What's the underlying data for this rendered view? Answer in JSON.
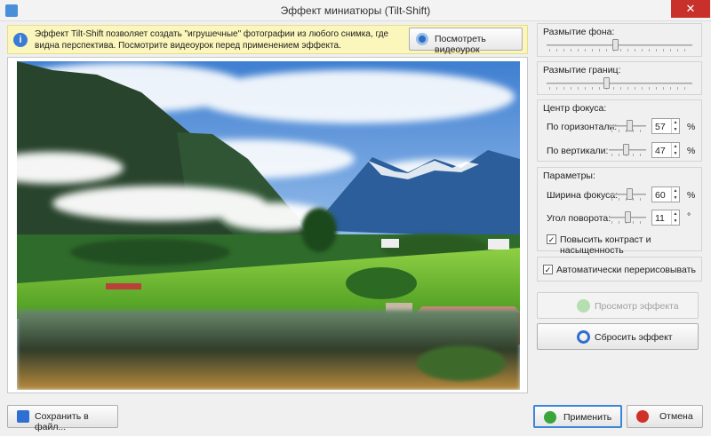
{
  "window": {
    "title": "Эффект миниатюры (Tilt-Shift)",
    "close_glyph": "✕"
  },
  "info": {
    "icon": "info-icon",
    "text": "Эффект Tilt-Shift позволяет создать \"игрушечные\" фотографии из любого снимка, где видна перспектива. Посмотрите видеоурок перед применением эффекта.",
    "video_button": "Посмотреть видеоурок"
  },
  "panel": {
    "bg_blur_label": "Размытие фона:",
    "edge_blur_label": "Размытие границ:",
    "focus_center_title": "Центр фокуса:",
    "horizontal_label": "По горизонтали:",
    "horizontal_value": "57",
    "vertical_label": "По вертикали:",
    "vertical_value": "47",
    "percent": "%",
    "params_title": "Параметры:",
    "focus_width_label": "Ширина фокуса:",
    "focus_width_value": "60",
    "rotation_label": "Угол поворота:",
    "rotation_value": "11",
    "degree": "°",
    "contrast_label": "Повысить контраст и насыщенность",
    "contrast_checked": true,
    "auto_redraw_label": "Автоматически перерисовывать",
    "auto_redraw_checked": true,
    "preview_button": "Просмотр эффекта",
    "reset_button": "Сбросить эффект",
    "check_glyph": "✓",
    "spin_up": "▲",
    "spin_down": "▼"
  },
  "bottom": {
    "save_button": "Сохранить в файл...",
    "apply_button": "Применить",
    "cancel_button": "Отмена"
  },
  "colors": {
    "accent": "#3b86d9",
    "close": "#c7302b",
    "info_bg": "#fbf6bb"
  }
}
